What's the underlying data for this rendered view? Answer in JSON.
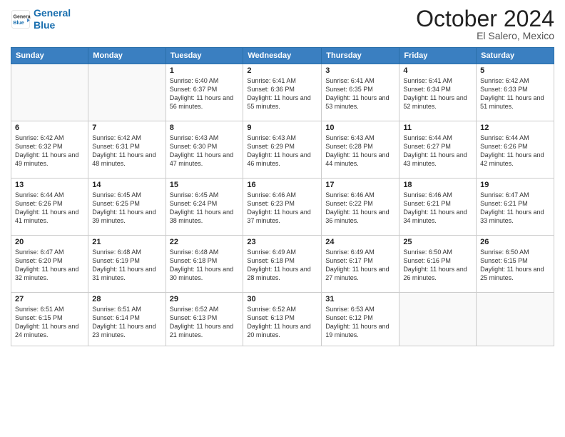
{
  "logo": {
    "line1": "General",
    "line2": "Blue",
    "icon": "▶"
  },
  "title": "October 2024",
  "location": "El Salero, Mexico",
  "days_header": [
    "Sunday",
    "Monday",
    "Tuesday",
    "Wednesday",
    "Thursday",
    "Friday",
    "Saturday"
  ],
  "weeks": [
    [
      {
        "day": "",
        "info": ""
      },
      {
        "day": "",
        "info": ""
      },
      {
        "day": "1",
        "info": "Sunrise: 6:40 AM\nSunset: 6:37 PM\nDaylight: 11 hours and 56 minutes."
      },
      {
        "day": "2",
        "info": "Sunrise: 6:41 AM\nSunset: 6:36 PM\nDaylight: 11 hours and 55 minutes."
      },
      {
        "day": "3",
        "info": "Sunrise: 6:41 AM\nSunset: 6:35 PM\nDaylight: 11 hours and 53 minutes."
      },
      {
        "day": "4",
        "info": "Sunrise: 6:41 AM\nSunset: 6:34 PM\nDaylight: 11 hours and 52 minutes."
      },
      {
        "day": "5",
        "info": "Sunrise: 6:42 AM\nSunset: 6:33 PM\nDaylight: 11 hours and 51 minutes."
      }
    ],
    [
      {
        "day": "6",
        "info": "Sunrise: 6:42 AM\nSunset: 6:32 PM\nDaylight: 11 hours and 49 minutes."
      },
      {
        "day": "7",
        "info": "Sunrise: 6:42 AM\nSunset: 6:31 PM\nDaylight: 11 hours and 48 minutes."
      },
      {
        "day": "8",
        "info": "Sunrise: 6:43 AM\nSunset: 6:30 PM\nDaylight: 11 hours and 47 minutes."
      },
      {
        "day": "9",
        "info": "Sunrise: 6:43 AM\nSunset: 6:29 PM\nDaylight: 11 hours and 46 minutes."
      },
      {
        "day": "10",
        "info": "Sunrise: 6:43 AM\nSunset: 6:28 PM\nDaylight: 11 hours and 44 minutes."
      },
      {
        "day": "11",
        "info": "Sunrise: 6:44 AM\nSunset: 6:27 PM\nDaylight: 11 hours and 43 minutes."
      },
      {
        "day": "12",
        "info": "Sunrise: 6:44 AM\nSunset: 6:26 PM\nDaylight: 11 hours and 42 minutes."
      }
    ],
    [
      {
        "day": "13",
        "info": "Sunrise: 6:44 AM\nSunset: 6:26 PM\nDaylight: 11 hours and 41 minutes."
      },
      {
        "day": "14",
        "info": "Sunrise: 6:45 AM\nSunset: 6:25 PM\nDaylight: 11 hours and 39 minutes."
      },
      {
        "day": "15",
        "info": "Sunrise: 6:45 AM\nSunset: 6:24 PM\nDaylight: 11 hours and 38 minutes."
      },
      {
        "day": "16",
        "info": "Sunrise: 6:46 AM\nSunset: 6:23 PM\nDaylight: 11 hours and 37 minutes."
      },
      {
        "day": "17",
        "info": "Sunrise: 6:46 AM\nSunset: 6:22 PM\nDaylight: 11 hours and 36 minutes."
      },
      {
        "day": "18",
        "info": "Sunrise: 6:46 AM\nSunset: 6:21 PM\nDaylight: 11 hours and 34 minutes."
      },
      {
        "day": "19",
        "info": "Sunrise: 6:47 AM\nSunset: 6:21 PM\nDaylight: 11 hours and 33 minutes."
      }
    ],
    [
      {
        "day": "20",
        "info": "Sunrise: 6:47 AM\nSunset: 6:20 PM\nDaylight: 11 hours and 32 minutes."
      },
      {
        "day": "21",
        "info": "Sunrise: 6:48 AM\nSunset: 6:19 PM\nDaylight: 11 hours and 31 minutes."
      },
      {
        "day": "22",
        "info": "Sunrise: 6:48 AM\nSunset: 6:18 PM\nDaylight: 11 hours and 30 minutes."
      },
      {
        "day": "23",
        "info": "Sunrise: 6:49 AM\nSunset: 6:18 PM\nDaylight: 11 hours and 28 minutes."
      },
      {
        "day": "24",
        "info": "Sunrise: 6:49 AM\nSunset: 6:17 PM\nDaylight: 11 hours and 27 minutes."
      },
      {
        "day": "25",
        "info": "Sunrise: 6:50 AM\nSunset: 6:16 PM\nDaylight: 11 hours and 26 minutes."
      },
      {
        "day": "26",
        "info": "Sunrise: 6:50 AM\nSunset: 6:15 PM\nDaylight: 11 hours and 25 minutes."
      }
    ],
    [
      {
        "day": "27",
        "info": "Sunrise: 6:51 AM\nSunset: 6:15 PM\nDaylight: 11 hours and 24 minutes."
      },
      {
        "day": "28",
        "info": "Sunrise: 6:51 AM\nSunset: 6:14 PM\nDaylight: 11 hours and 23 minutes."
      },
      {
        "day": "29",
        "info": "Sunrise: 6:52 AM\nSunset: 6:13 PM\nDaylight: 11 hours and 21 minutes."
      },
      {
        "day": "30",
        "info": "Sunrise: 6:52 AM\nSunset: 6:13 PM\nDaylight: 11 hours and 20 minutes."
      },
      {
        "day": "31",
        "info": "Sunrise: 6:53 AM\nSunset: 6:12 PM\nDaylight: 11 hours and 19 minutes."
      },
      {
        "day": "",
        "info": ""
      },
      {
        "day": "",
        "info": ""
      }
    ]
  ]
}
